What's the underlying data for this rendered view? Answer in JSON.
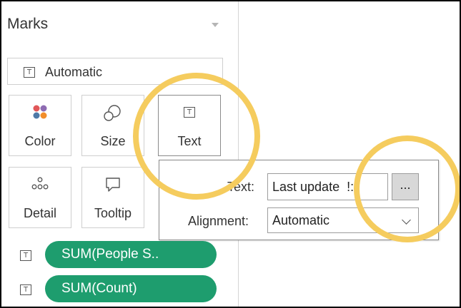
{
  "marks": {
    "title": "Marks",
    "mark_type": "Automatic",
    "tiles": {
      "color": "Color",
      "size": "Size",
      "text": "Text",
      "detail": "Detail",
      "tooltip": "Tooltip"
    },
    "t_glyph": "T",
    "pills": [
      {
        "label": "SUM(People S.."
      },
      {
        "label": "SUM(Count)"
      }
    ]
  },
  "text_popover": {
    "text_label": "Text:",
    "text_value": "Last update  !:",
    "ellipsis_label": "...",
    "alignment_label": "Alignment:",
    "alignment_value": "Automatic"
  },
  "colors": {
    "pill_green": "#1e9d6e",
    "highlight_yellow": "#f5cc5e",
    "color_dots": [
      "#e15759",
      "#8e6bb2",
      "#4e79a7",
      "#f28e2b"
    ]
  }
}
